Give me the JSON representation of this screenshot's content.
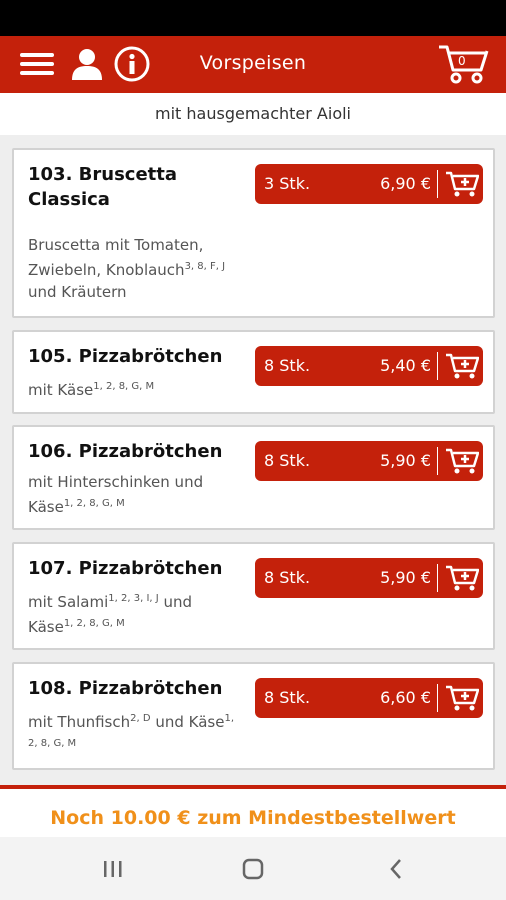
{
  "header": {
    "title": "Vorspeisen",
    "cart_count": "0"
  },
  "subtitle": "mit hausgemachter Aioli",
  "items": [
    {
      "name": "103. Bruscetta Classica",
      "desc_html": "Bruscetta mit Tomaten, Zwiebeln, Knoblauch<sup>3, 8, F, J</sup> und Kräutern",
      "qty": "3 Stk.",
      "price": "6,90 €"
    },
    {
      "name": "105. Pizzabrötchen",
      "desc_html": "mit Käse<sup>1, 2, 8, G, M</sup>",
      "qty": "8 Stk.",
      "price": "5,40 €"
    },
    {
      "name": "106. Pizzabrötchen",
      "desc_html": "mit Hinterschinken und Käse<sup>1, 2, 8, G, M</sup>",
      "qty": "8 Stk.",
      "price": "5,90 €"
    },
    {
      "name": "107. Pizzabrötchen",
      "desc_html": "mit Salami<sup>1, 2, 3, I, J</sup> und Käse<sup>1, 2, 8, G, M</sup>",
      "qty": "8 Stk.",
      "price": "5,90 €"
    },
    {
      "name": "108. Pizzabrötchen",
      "desc_html": "mit Thunfisch<sup>2, D</sup> und Käse<sup>1, 2, 8, G, M</sup>",
      "qty": "8 Stk.",
      "price": "6,60 €"
    }
  ],
  "footer": {
    "min_order_text": "Noch 10.00 € zum Mindestbestellwert"
  },
  "colors": {
    "brand": "#c4210b",
    "footer_text": "#f0901a"
  },
  "icons": [
    "menu-icon",
    "user-icon",
    "info-icon",
    "cart-icon",
    "add-to-cart-icon",
    "recent-apps-icon",
    "home-icon",
    "back-icon"
  ]
}
